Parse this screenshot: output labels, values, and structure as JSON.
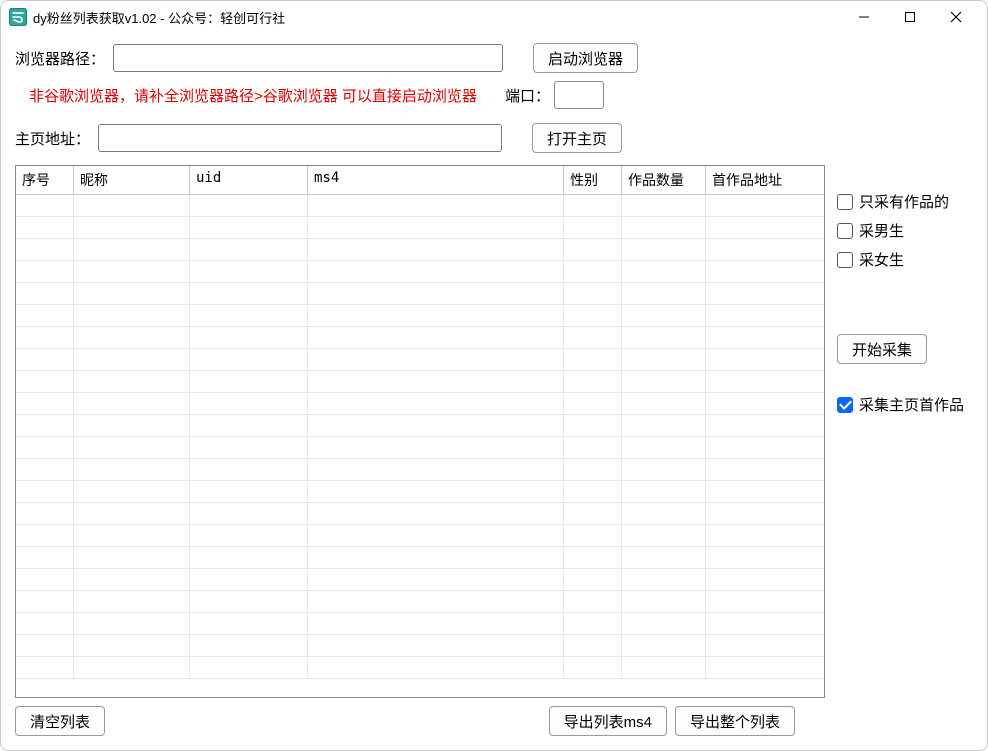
{
  "window": {
    "title": "dy粉丝列表获取v1.02 - 公众号：轻创可行社"
  },
  "labels": {
    "browser_path": "浏览器路径：",
    "port": "端口：",
    "home_url": "主页地址：",
    "hint": "非谷歌浏览器，请补全浏览器路径>谷歌浏览器 可以直接启动浏览器"
  },
  "buttons": {
    "launch_browser": "启动浏览器",
    "open_home": "打开主页",
    "start_collect": "开始采集",
    "clear_list": "清空列表",
    "export_ms4": "导出列表ms4",
    "export_all": "导出整个列表"
  },
  "inputs": {
    "browser_path_value": "",
    "port_value": "",
    "home_url_value": ""
  },
  "checkboxes": {
    "only_has_works": {
      "label": "只采有作品的",
      "checked": false
    },
    "collect_male": {
      "label": "采男生",
      "checked": false
    },
    "collect_female": {
      "label": "采女生",
      "checked": false
    },
    "collect_first_work": {
      "label": "采集主页首作品",
      "checked": true
    }
  },
  "table": {
    "columns": [
      "序号",
      "昵称",
      "uid",
      "ms4",
      "性别",
      "作品数量",
      "首作品地址"
    ],
    "rows": []
  }
}
